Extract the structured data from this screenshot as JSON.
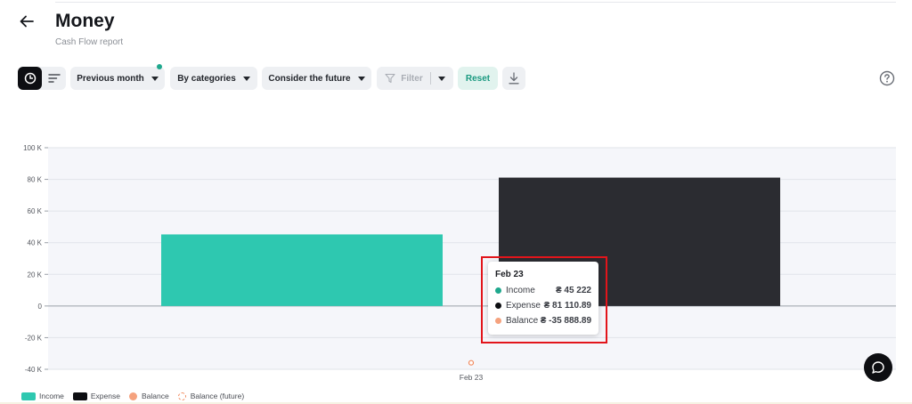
{
  "header": {
    "title": "Money",
    "subtitle": "Cash Flow report"
  },
  "toolbar": {
    "period_label": "Previous month",
    "group_label": "By categories",
    "future_label": "Consider the future",
    "filter_label": "Filter",
    "reset_label": "Reset"
  },
  "colors": {
    "income": "#2ec8b0",
    "expense": "#2b2c31",
    "balance": "#f5a27e",
    "accent": "#1fa88d"
  },
  "chart_data": {
    "type": "bar",
    "categories": [
      "Feb 23"
    ],
    "series": [
      {
        "name": "Income",
        "values": [
          45222
        ]
      },
      {
        "name": "Expense",
        "values": [
          81110.89
        ]
      },
      {
        "name": "Balance",
        "values": [
          -35888.89
        ]
      }
    ],
    "ylim": [
      -40000,
      100000
    ],
    "yticks": [
      {
        "value": 100000,
        "label": "100 K"
      },
      {
        "value": 80000,
        "label": "80 K"
      },
      {
        "value": 60000,
        "label": "60 K"
      },
      {
        "value": 40000,
        "label": "40 K"
      },
      {
        "value": 20000,
        "label": "20 K"
      },
      {
        "value": 0,
        "label": "0"
      },
      {
        "value": -20000,
        "label": "-20 K"
      },
      {
        "value": -40000,
        "label": "-40 K"
      }
    ],
    "grid": true,
    "legend_position": "bottom-left",
    "legend": [
      "Income",
      "Expense",
      "Balance",
      "Balance (future)"
    ]
  },
  "tooltip": {
    "date": "Feb 23",
    "rows": [
      {
        "label": "Income",
        "value": "₴ 45 222"
      },
      {
        "label": "Expense",
        "value": "₴ 81 110.89"
      },
      {
        "label": "Balance",
        "value": "₴ -35 888.89"
      }
    ]
  }
}
